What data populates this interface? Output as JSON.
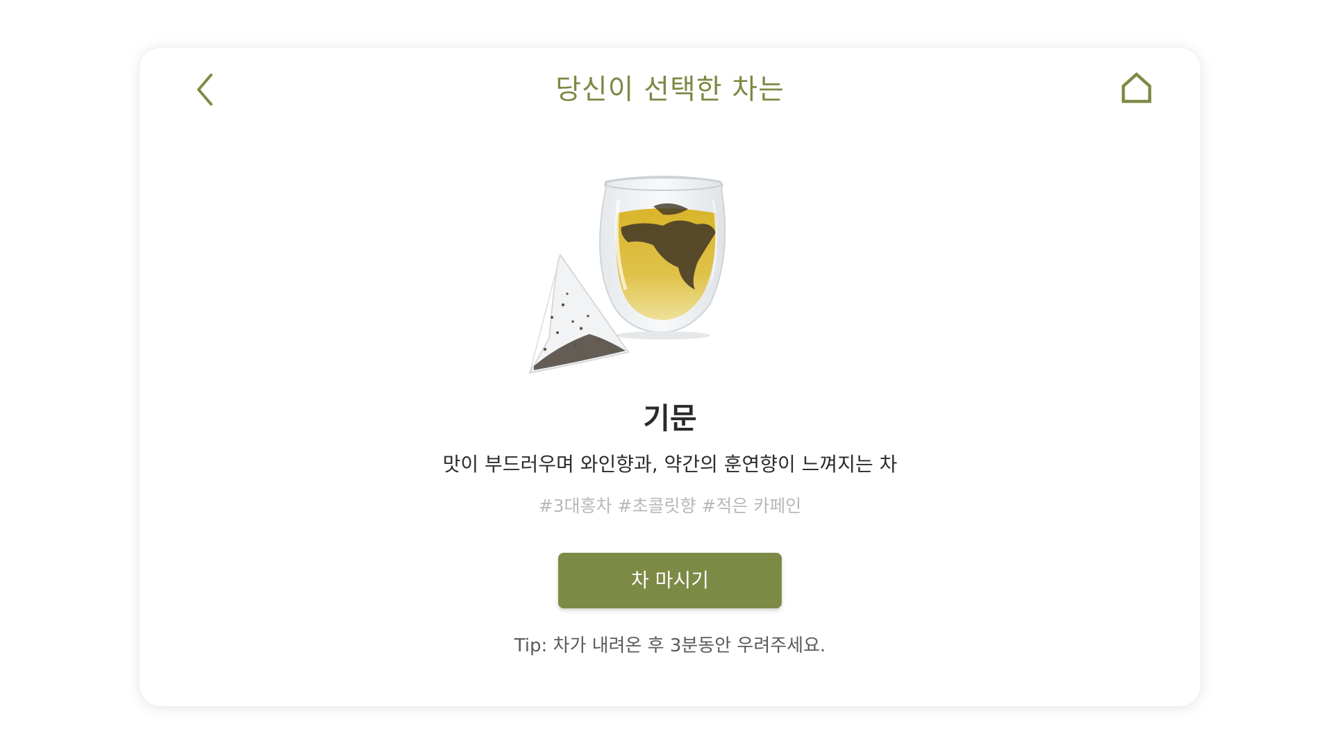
{
  "header": {
    "title": "당신이 선택한 차는",
    "back_icon": "chevron-left-icon",
    "home_icon": "home-icon"
  },
  "tea": {
    "image_alt": "tea cup and tea bag",
    "name": "기문",
    "description": "맛이 부드러우며 와인향과, 약간의 훈연향이 느껴지는 차",
    "tags": "#3대홍차 #초콜릿향 #적은 카페인"
  },
  "actions": {
    "drink_label": "차 마시기"
  },
  "tip": "Tip: 차가 내려온 후 3분동안 우려주세요.",
  "colors": {
    "accent": "#7c8a46",
    "text": "#2b2b2b",
    "tags": "#b8b8b8",
    "tip": "#5a5a5a"
  }
}
